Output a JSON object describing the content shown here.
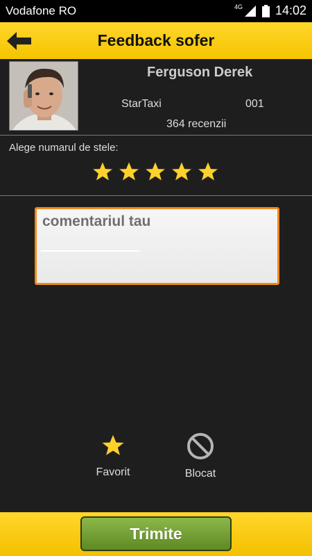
{
  "status_bar": {
    "carrier": "Vodafone RO",
    "network": "4G",
    "time": "14:02"
  },
  "header": {
    "title": "Feedback sofer",
    "back_icon": "arrow-left-icon"
  },
  "driver": {
    "name": "Ferguson Derek",
    "company": "StarTaxi",
    "code": "001",
    "reviews": "364 recenzii"
  },
  "rating": {
    "label": "Alege numarul de stele:",
    "stars_selected": 5,
    "stars_total": 5
  },
  "comment": {
    "placeholder": "comentariul tau",
    "value": ""
  },
  "actions": {
    "favorite_label": "Favorit",
    "block_label": "Blocat"
  },
  "submit": {
    "label": "Trimite"
  },
  "colors": {
    "accent_yellow": "#ffd62a",
    "star_yellow": "#ffd12a",
    "comment_border": "#f08a1c",
    "submit_green": "#6f9a30",
    "background": "#1e1e1e"
  }
}
